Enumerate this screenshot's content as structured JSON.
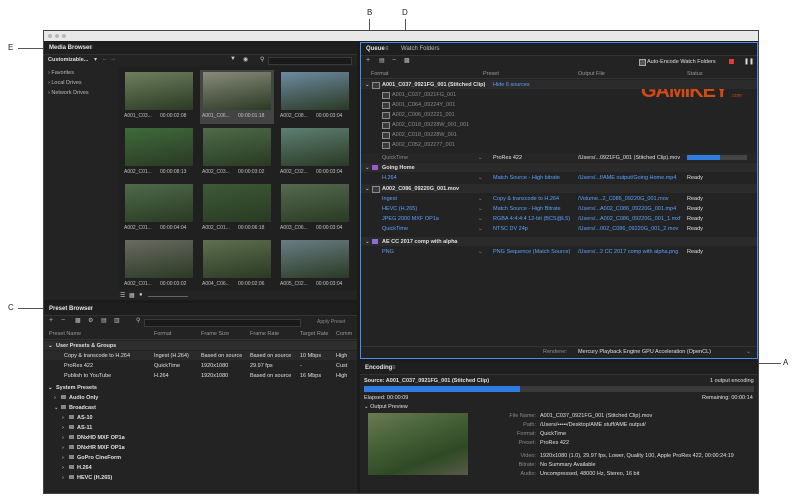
{
  "callouts": {
    "a": "A",
    "b": "B",
    "c": "C",
    "d": "D",
    "e": "E"
  },
  "media_browser": {
    "title": "Media Browser",
    "dropdown": "Customizable...",
    "tree": [
      "Favorites",
      "Local Drives",
      "Network Drives"
    ],
    "thumbs": [
      {
        "name": "A001_C03...",
        "dur": "00:00:02:08",
        "color": "#6f7f5e"
      },
      {
        "name": "A001_C06...",
        "dur": "00:00:01:18",
        "color": "#8a8a7a"
      },
      {
        "name": "A002_C08...",
        "dur": "00:00:03:04",
        "color": "#6d8aa0"
      },
      {
        "name": "A002_C01...",
        "dur": "00:00:08:13",
        "color": "#3f6a3c"
      },
      {
        "name": "A002_C03...",
        "dur": "00:00:03:02",
        "color": "#4e6b48"
      },
      {
        "name": "A002_C02...",
        "dur": "00:00:03:04",
        "color": "#5e7f74"
      },
      {
        "name": "A002_C01...",
        "dur": "00:00:04:04",
        "color": "#4f6a4a"
      },
      {
        "name": "A002_C01...",
        "dur": "00:00:06:18",
        "color": "#3d5a36"
      },
      {
        "name": "A003_C06...",
        "dur": "00:00:03:04",
        "color": "#556a50"
      },
      {
        "name": "A002_C01...",
        "dur": "00:00:03:02",
        "color": "#6b6a62"
      },
      {
        "name": "A004_C06...",
        "dur": "00:00:02:06",
        "color": "#5f6f4f"
      },
      {
        "name": "A005_C02...",
        "dur": "00:00:03:04",
        "color": "#6a7d84"
      }
    ]
  },
  "preset_browser": {
    "title": "Preset Browser",
    "apply_label": "Apply Preset",
    "columns": [
      "Preset Name",
      "Format",
      "Frame Size",
      "Frame Rate",
      "Target Rate",
      "Comm"
    ],
    "user_group": "User Presets & Groups",
    "user_presets": [
      {
        "name": "Copy & transcode to H.264",
        "format": "Ingest (H.264)",
        "size": "Based on source",
        "rate": "Based on source",
        "target": "10 Mbps",
        "comm": "High"
      },
      {
        "name": "ProRes 422",
        "format": "QuickTime",
        "size": "1920x1080",
        "rate": "29.97 fps",
        "target": "-",
        "comm": "Cust"
      },
      {
        "name": "Publish to YouTube",
        "format": "H.264",
        "size": "1920x1080",
        "rate": "Based on source",
        "target": "16 Mbps",
        "comm": "High"
      }
    ],
    "system_group": "System Presets",
    "system_presets": [
      "Audio Only",
      "Broadcast",
      "AS-10",
      "AS-11",
      "DNxHD MXF OP1a",
      "DNxHR MXF OP1a",
      "GoPro CineForm",
      "H.264",
      "HEVC (H.265)"
    ]
  },
  "queue": {
    "tab_queue": "Queue",
    "tab_watch": "Watch Folders",
    "auto_encode": "Auto-Encode Watch Folders",
    "columns": [
      "Format",
      "Preset",
      "Output File",
      "Status"
    ],
    "item1": "A001_C037_0921FG_001 (Stitched Clip)",
    "hide_sources": "Hide 6 sources",
    "sources": [
      "A001_C037_0921FG_001",
      "A001_C064_09224Y_001",
      "A002_C006_092221_001",
      "A002_C018_09228W_001_001",
      "A002_C018_09228W_001",
      "A002_C052_092277_001"
    ],
    "item1_format": "QuickTime",
    "item1_preset": "ProRes 422",
    "item1_output": "/Users/...0921FG_001 (Stitched Clip).mov",
    "item1_progress": 0.55,
    "item2": "Going Home",
    "item2_format": "H.264",
    "item2_preset": "Match Source - High bitrate",
    "item2_output": "/Users/...f/AME output/Going Home.mp4",
    "item2_status": "Ready",
    "item3": "A002_C086_09220G_001.mov",
    "item3_rows": [
      {
        "format": "Ingest",
        "preset": "Copy & transcode to H.264",
        "output": "/Volume...2_C086_09220G_001.mov",
        "status": "Ready"
      },
      {
        "format": "HEVC (H.265)",
        "preset": "Match Source - High Bitrate",
        "output": "/Users/...A002_C086_09220G_001.mp4",
        "status": "Ready"
      },
      {
        "format": "JPEG 2000 MXF OP1a",
        "preset": "RGBA 4:4:4:4 12-bit (BCS@L5)",
        "output": "/Users/...A002_C086_09220G_001_1.mxf",
        "status": "Ready"
      },
      {
        "format": "QuickTime",
        "preset": "NTSC DV 24p",
        "output": "/Users/...002_C086_09220G_001_2.mov",
        "status": "Ready"
      }
    ],
    "item4": "AE CC 2017 comp with alpha",
    "item4_format": "PNG",
    "item4_preset": "PNG Sequence (Match Source)",
    "item4_output": "/Users/...2 CC 2017 comp with alpha.png",
    "item4_status": "Ready",
    "renderer_label": "Renderer:",
    "renderer_value": "Mercury Playback Engine GPU Acceleration (OpenCL)"
  },
  "watermark": {
    "text": "GAMIKEY",
    "suffix": ".com"
  },
  "encoding": {
    "title": "Encoding",
    "source": "Source: A001_C037_0921FG_001 (Stitched Clip)",
    "count": "1 output encoding",
    "progress": 0.4,
    "elapsed": "Elapsed: 00:00:09",
    "remaining": "Remaining: 00:00:14",
    "output_preview": "Output Preview",
    "details": [
      {
        "k": "File Name:",
        "v": "A001_C037_0921FG_001 (Stitched Clip).mov"
      },
      {
        "k": "Path:",
        "v": "/Users/•••••/Desktop/AME stuff/AME output/"
      },
      {
        "k": "Format:",
        "v": "QuickTime"
      },
      {
        "k": "Preset:",
        "v": "ProRes 422"
      },
      {
        "k": "Video:",
        "v": "1920x1080 (1.0), 29.97 fps, Lower, Quality 100, Apple ProRes 422, 00:00:24:19"
      },
      {
        "k": "Bitrate:",
        "v": "No Summary Available"
      },
      {
        "k": "Audio:",
        "v": "Uncompressed, 48000 Hz, Stereo, 16 bit"
      }
    ]
  }
}
